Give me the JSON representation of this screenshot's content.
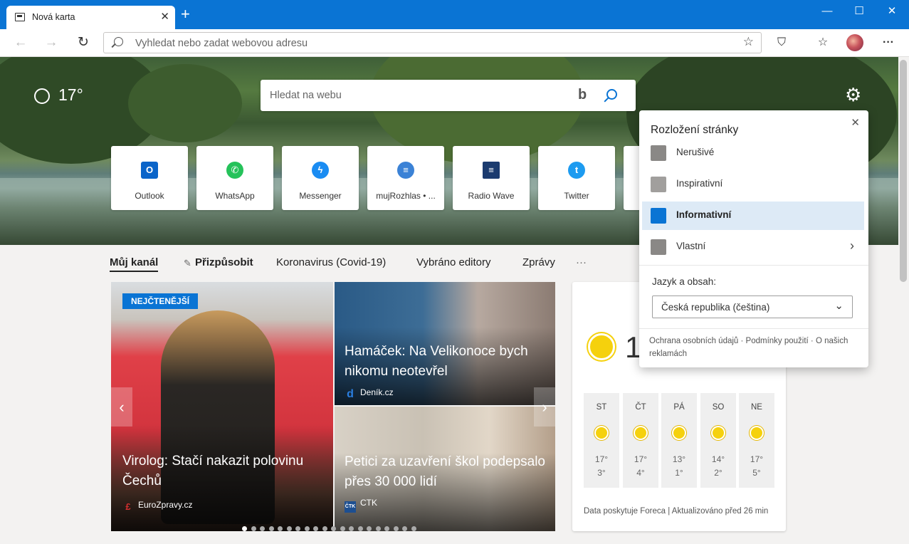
{
  "browser": {
    "tab_title": "Nová karta",
    "close_tab": "✕",
    "new_tab": "+",
    "window_controls": {
      "minimize": "—",
      "maximize": "☐",
      "close": "✕"
    },
    "address_placeholder": "Vyhledat nebo zadat webovou adresu",
    "more_label": "···"
  },
  "hero": {
    "temperature": "17°",
    "search_placeholder": "Hledat na webu",
    "bing_glyph": "b"
  },
  "quick_links": [
    {
      "label": "Outlook",
      "icon": "outlook-icon",
      "color": "#0a64c9",
      "glyph": "O"
    },
    {
      "label": "WhatsApp",
      "icon": "whatsapp-icon",
      "color": "#25c25a",
      "glyph": "✆"
    },
    {
      "label": "Messenger",
      "icon": "messenger-icon",
      "color": "#1a8cf2",
      "glyph": "ϟ"
    },
    {
      "label": "mujRozhlas • ...",
      "icon": "mujrozhlas-icon",
      "color": "#3b82d6",
      "glyph": "≡"
    },
    {
      "label": "Radio Wave",
      "icon": "radiowave-icon",
      "color": "#1b3b6f",
      "glyph": "≡"
    },
    {
      "label": "Twitter",
      "icon": "twitter-icon",
      "color": "#1d9bf0",
      "glyph": "t"
    }
  ],
  "nav": {
    "items": [
      {
        "label": "Můj kanál"
      },
      {
        "label": "Přizpůsobit"
      },
      {
        "label": "Koronavirus (Covid-19)"
      },
      {
        "label": "Vybráno editory"
      },
      {
        "label": "Zprávy"
      },
      {
        "label": "···"
      }
    ]
  },
  "feed": {
    "feature": {
      "badge": "NEJČTENĚJŠÍ",
      "headline": "Virolog: Stačí nakazit polovinu Čechů",
      "source": "EuroZpravy.cz"
    },
    "card2": {
      "headline": "Hamáček: Na Velikonoce bych nikomu neotevřel",
      "source": "Deník.cz"
    },
    "card3": {
      "headline": "Petici za uzavření škol podepsalo přes 30 000 lidí",
      "source": "CTK"
    },
    "carousel_dots": 20,
    "carousel_active": 0
  },
  "weather": {
    "current_temp": "1",
    "days": [
      {
        "name": "ST",
        "hi": "17°",
        "lo": "3°"
      },
      {
        "name": "ČT",
        "hi": "17°",
        "lo": "4°"
      },
      {
        "name": "PÁ",
        "hi": "13°",
        "lo": "1°"
      },
      {
        "name": "SO",
        "hi": "14°",
        "lo": "2°"
      },
      {
        "name": "NE",
        "hi": "17°",
        "lo": "5°"
      }
    ],
    "footer": "Data poskytuje Foreca | Aktualizováno před 26 min"
  },
  "layout_panel": {
    "title": "Rozložení stránky",
    "options": [
      {
        "label": "Nerušivé",
        "selected": false
      },
      {
        "label": "Inspirativní",
        "selected": false
      },
      {
        "label": "Informativní",
        "selected": true
      },
      {
        "label": "Vlastní",
        "selected": false
      }
    ],
    "language_label": "Jazyk a obsah:",
    "language_value": "Česká republika (čeština)",
    "links": "Ochrana osobních údajů · Podmínky použití · O našich reklamách"
  }
}
